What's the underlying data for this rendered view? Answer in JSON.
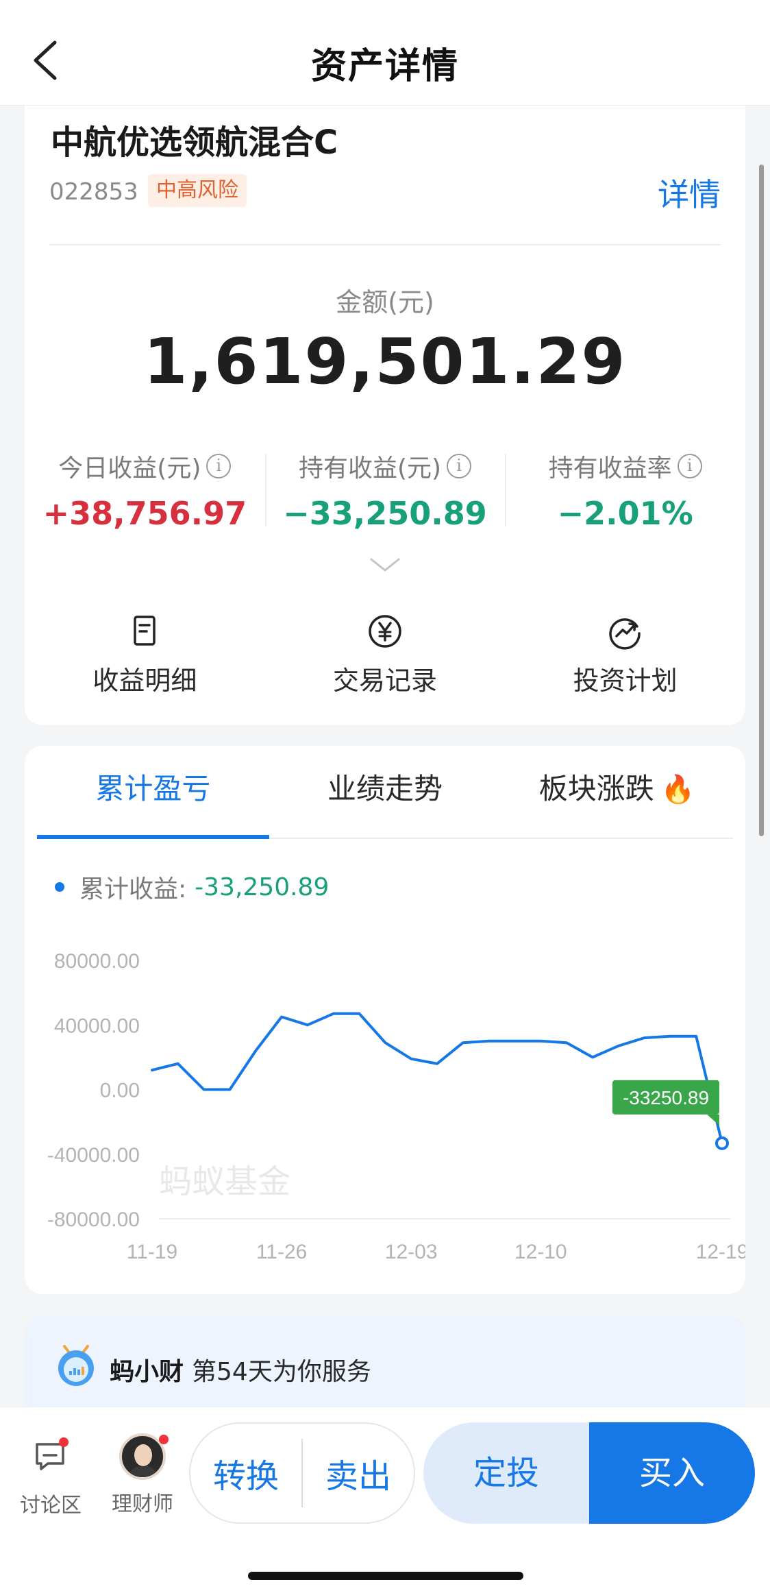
{
  "nav": {
    "title": "资产详情"
  },
  "fund": {
    "name": "中航优选领航混合C",
    "code": "022853",
    "risk": "中高风险",
    "detail_link": "详情",
    "amount_label": "金额(元)",
    "amount": "1,619,501.29"
  },
  "stats": [
    {
      "label": "今日收益(元)",
      "value": "+38,756.97",
      "color": "#d6303f"
    },
    {
      "label": "持有收益(元)",
      "value": "−33,250.89",
      "color": "#17a079"
    },
    {
      "label": "持有收益率",
      "value": "−2.01%",
      "color": "#17a079"
    }
  ],
  "actions": [
    {
      "label": "收益明细",
      "icon": "document-icon"
    },
    {
      "label": "交易记录",
      "icon": "yen-circle-icon"
    },
    {
      "label": "投资计划",
      "icon": "trend-circle-icon"
    }
  ],
  "tabs": [
    {
      "label": "累计盈亏",
      "active": true
    },
    {
      "label": "业绩走势",
      "active": false
    },
    {
      "label": "板块涨跌",
      "active": false,
      "badge": "fire-icon"
    }
  ],
  "legend": {
    "label": "累计收益:",
    "value": "-33,250.89"
  },
  "chart_data": {
    "type": "line",
    "watermark": "蚂蚁基金",
    "y_ticks": [
      "80000.00",
      "40000.00",
      "0.00",
      "-40000.00",
      "-80000.00"
    ],
    "x_ticks": [
      "11-19",
      "11-26",
      "12-03",
      "12-10",
      "12-19"
    ],
    "ylim": [
      -80000,
      80000
    ],
    "series": [
      {
        "color": "#1677e6",
        "x": [
          "11-19",
          "11-20",
          "11-21",
          "11-22",
          "11-25",
          "11-26",
          "11-27",
          "11-28",
          "11-29",
          "12-02",
          "12-03",
          "12-04",
          "12-05",
          "12-06",
          "12-09",
          "12-10",
          "12-11",
          "12-12",
          "12-13",
          "12-16",
          "12-17",
          "12-18",
          "12-19"
        ],
        "values": [
          12000,
          16000,
          0,
          0,
          24000,
          45000,
          40000,
          47000,
          47000,
          29000,
          19000,
          16000,
          29000,
          30000,
          30000,
          30000,
          29000,
          20000,
          27000,
          32000,
          33000,
          33000,
          -33250.89
        ]
      }
    ],
    "tooltip": "-33250.89",
    "grid": true
  },
  "promo": {
    "name": "蚂小财",
    "text": "第54天为你服务"
  },
  "bottom": {
    "discuss": "讨论区",
    "advisor": "理财师",
    "convert": "转换",
    "sell": "卖出",
    "auto_invest": "定投",
    "buy": "买入"
  }
}
